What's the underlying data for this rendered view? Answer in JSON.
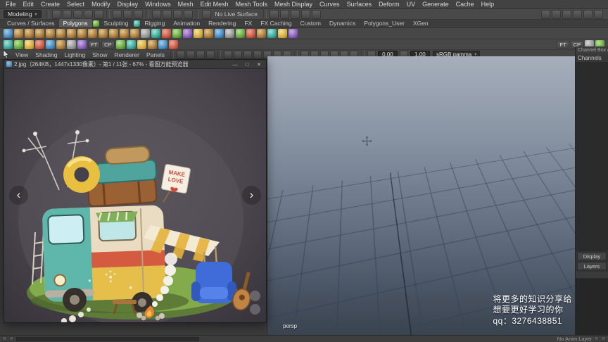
{
  "menu_bar": {
    "items": [
      "File",
      "Edit",
      "Create",
      "Select",
      "Modify",
      "Display",
      "Windows",
      "Mesh",
      "Edit Mesh",
      "Mesh Tools",
      "Mesh Display",
      "Curves",
      "Surfaces",
      "Deform",
      "UV",
      "Generate",
      "Cache",
      "Help"
    ]
  },
  "status_line": {
    "mode": "Modeling",
    "live_surface": "No Live Surface"
  },
  "shelf": {
    "tabs": [
      "Curves / Surfaces",
      "Polygons",
      "Sculpting",
      "Rigging",
      "Animation",
      "Rendering",
      "FX",
      "FX Caching",
      "Custom",
      "Dynamics",
      "Polygons_User",
      "XGen"
    ],
    "ft_label": "FT",
    "cp_label": "CP"
  },
  "panel_bar": {
    "menus": [
      "View",
      "Shading",
      "Lighting",
      "Show",
      "Renderer",
      "Panels"
    ],
    "exposure": "0.00",
    "gamma": "1.00",
    "view_transform": "sRGB gamma"
  },
  "image_viewer": {
    "title": "2.jpg（264KB，1447x1330像素）- 第1 / 11张 - 67% - 看图万能预览器",
    "minimize": "—",
    "maximize": "□",
    "close": "✕",
    "prev": "‹",
    "next": "›",
    "sign": {
      "line1": "MAKE",
      "line2": "LOVE"
    }
  },
  "viewport": {
    "camera": "persp"
  },
  "channel_box": {
    "header": "Channel Box / Layer Editor",
    "menu": "Channels",
    "tabs": {
      "display": "Display",
      "layers": "Layers"
    }
  },
  "status_bar": {
    "anim_layer": "No Anim Layer"
  },
  "overlay": {
    "line1": "将更多的知识分享给",
    "line2": "想要更好学习的你",
    "line3": "qq：3276438851"
  },
  "colors": {
    "viewport_top": "#a6aebb",
    "viewport_bottom": "#3a4450",
    "grid_line": "#34425a",
    "ui_bg": "#454545"
  }
}
